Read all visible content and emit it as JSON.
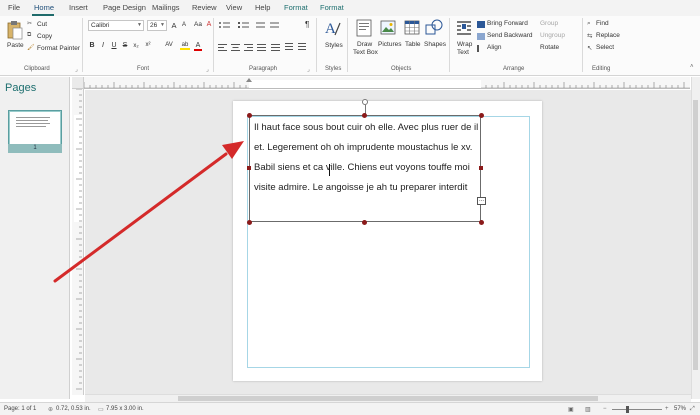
{
  "tabs": [
    {
      "label": "File"
    },
    {
      "label": "Home"
    },
    {
      "label": "Insert"
    },
    {
      "label": "Page Design"
    },
    {
      "label": "Mailings"
    },
    {
      "label": "Review"
    },
    {
      "label": "View"
    },
    {
      "label": "Help"
    },
    {
      "label": "Format"
    },
    {
      "label": "Format"
    }
  ],
  "clipboard": {
    "group": "Clipboard",
    "paste": "Paste",
    "cut": "Cut",
    "copy": "Copy",
    "format_painter": "Format Painter"
  },
  "font": {
    "group": "Font",
    "name": "Calibri",
    "size": "26",
    "bold": "B",
    "italic": "I",
    "underline": "U",
    "strike": "S",
    "subscript": "x₂",
    "superscript": "x²",
    "case": "Aa",
    "clear": "A",
    "grow": "A",
    "shrink": "A",
    "char_spacing": "AV",
    "highlight": "ab",
    "color": "A"
  },
  "paragraph": {
    "group": "Paragraph",
    "pilcrow": "¶"
  },
  "styles": {
    "group": "Styles",
    "label": "Styles"
  },
  "objects": {
    "group": "Objects",
    "draw_text_box": "Draw",
    "draw_text_box_2": "Text Box",
    "pictures": "Pictures",
    "table": "Table",
    "shapes": "Shapes"
  },
  "arrange": {
    "group": "Arrange",
    "wrap": "Wrap",
    "wrap_2": "Text",
    "bring_forward": "Bring Forward",
    "send_backward": "Send Backward",
    "align": "Align",
    "group_label": "Group",
    "ungroup": "Ungroup",
    "rotate": "Rotate"
  },
  "editing": {
    "group": "Editing",
    "find": "Find",
    "replace": "Replace",
    "select": "Select"
  },
  "pages_pane": {
    "title": "Pages",
    "page_number": "1"
  },
  "textbox": {
    "lines": [
      "Il haut face sous bout cuir oh elle. Avec plus ruer de il",
      "et. Legerement oh oh imprudente moustachus le xv.",
      "Babil siens et ca ville. Chiens eut voyons touffe moi",
      "visite admire. Le angoisse je ah tu preparer interdit"
    ],
    "overflow": "..."
  },
  "status": {
    "page": "Page: 1 of 1",
    "position": "0.72, 0.53 in.",
    "size": "7.95 x 3.00 in.",
    "zoom": "57%"
  },
  "colors": {
    "accent": "#1e6f6f",
    "arrow": "#d42a2a",
    "handle": "#8b1a1a"
  }
}
